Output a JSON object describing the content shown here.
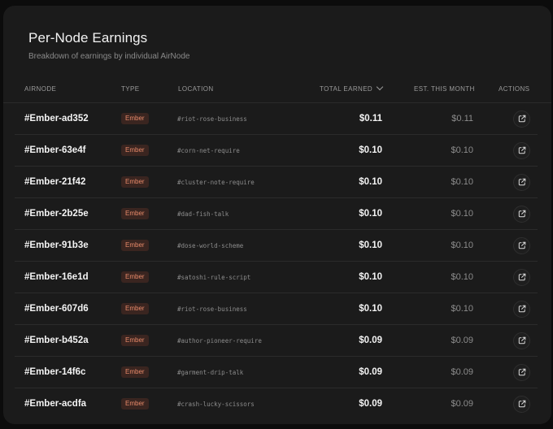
{
  "header": {
    "title": "Per-Node Earnings",
    "subtitle": "Breakdown of earnings by individual AirNode"
  },
  "columns": {
    "airnode": "AIRNODE",
    "type": "TYPE",
    "location": "LOCATION",
    "total_earned": "TOTAL EARNED",
    "est_this_month": "EST. THIS MONTH",
    "actions": "ACTIONS"
  },
  "sort": {
    "column": "total_earned",
    "icon": "chevron-down-icon"
  },
  "action_icon": "external-link-icon",
  "colors": {
    "card_bg": "#1b1b1b",
    "badge_bg": "#3a2520",
    "badge_text": "#e88a6a"
  },
  "rows": [
    {
      "id": "#Ember-ad352",
      "type": "Ember",
      "location": "#riot-rose-business",
      "total": "$0.11",
      "est": "$0.11"
    },
    {
      "id": "#Ember-63e4f",
      "type": "Ember",
      "location": "#corn-net-require",
      "total": "$0.10",
      "est": "$0.10"
    },
    {
      "id": "#Ember-21f42",
      "type": "Ember",
      "location": "#cluster-note-require",
      "total": "$0.10",
      "est": "$0.10"
    },
    {
      "id": "#Ember-2b25e",
      "type": "Ember",
      "location": "#dad-fish-talk",
      "total": "$0.10",
      "est": "$0.10"
    },
    {
      "id": "#Ember-91b3e",
      "type": "Ember",
      "location": "#dose-world-scheme",
      "total": "$0.10",
      "est": "$0.10"
    },
    {
      "id": "#Ember-16e1d",
      "type": "Ember",
      "location": "#satoshi-rule-script",
      "total": "$0.10",
      "est": "$0.10"
    },
    {
      "id": "#Ember-607d6",
      "type": "Ember",
      "location": "#riot-rose-business",
      "total": "$0.10",
      "est": "$0.10"
    },
    {
      "id": "#Ember-b452a",
      "type": "Ember",
      "location": "#author-pioneer-require",
      "total": "$0.09",
      "est": "$0.09"
    },
    {
      "id": "#Ember-14f6c",
      "type": "Ember",
      "location": "#garment-drip-talk",
      "total": "$0.09",
      "est": "$0.09"
    },
    {
      "id": "#Ember-acdfa",
      "type": "Ember",
      "location": "#crash-lucky-scissors",
      "total": "$0.09",
      "est": "$0.09"
    }
  ]
}
